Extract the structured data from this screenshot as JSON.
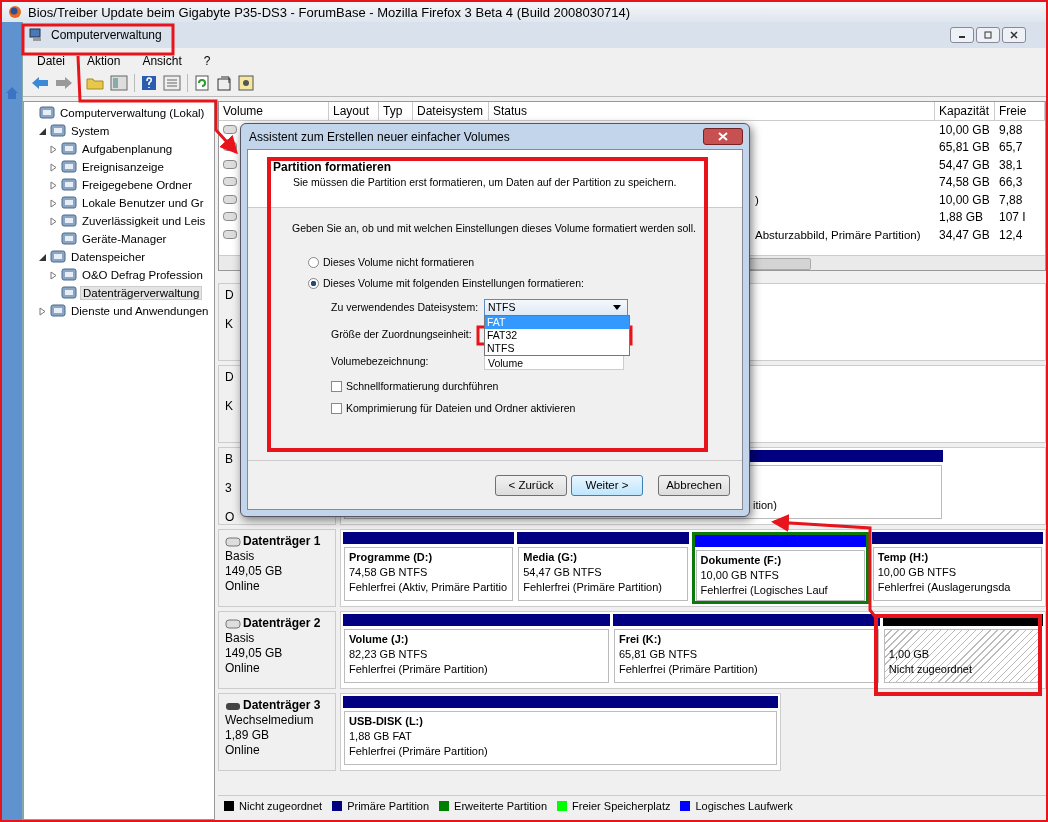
{
  "browser_title": "Bios/Treiber Update beim Gigabyte P35-DS3 - ForumBase - Mozilla Firefox 3 Beta 4 (Build 2008030714)",
  "window": {
    "title": "Computerverwaltung"
  },
  "menu": [
    "Datei",
    "Aktion",
    "Ansicht",
    "?"
  ],
  "tree": [
    {
      "label": "Computerverwaltung (Lokal)",
      "selected": false,
      "children": [
        {
          "label": "System",
          "selected": false,
          "expanded": true,
          "children": [
            {
              "label": "Aufgabenplanung",
              "selected": false,
              "expanded": false
            },
            {
              "label": "Ereignisanzeige",
              "selected": false,
              "expanded": false
            },
            {
              "label": "Freigegebene Ordner",
              "selected": false,
              "expanded": false
            },
            {
              "label": "Lokale Benutzer und Gr",
              "selected": false,
              "expanded": false
            },
            {
              "label": "Zuverlässigkeit und Leis",
              "selected": false,
              "expanded": false
            },
            {
              "label": "Geräte-Manager",
              "selected": false
            }
          ]
        },
        {
          "label": "Datenspeicher",
          "selected": false,
          "expanded": true,
          "children": [
            {
              "label": "O&O Defrag Profession",
              "selected": false,
              "expanded": false
            },
            {
              "label": "Datenträgerverwaltung",
              "selected": true
            }
          ]
        },
        {
          "label": "Dienste und Anwendungen",
          "selected": false,
          "expanded": false
        }
      ]
    }
  ],
  "volume_table": {
    "columns": [
      "Volume",
      "Layout",
      "Typ",
      "Dateisystem",
      "Status",
      "Kapazität",
      "Freie"
    ],
    "rows": [
      {
        "capacity": "10,00 GB",
        "free": "9,88"
      },
      {
        "capacity": "65,81 GB",
        "free": "65,7"
      },
      {
        "capacity": "54,47 GB",
        "free": "38,1"
      },
      {
        "capacity": "74,58 GB",
        "free": "66,3"
      },
      {
        "status": ")",
        "capacity": "10,00 GB",
        "free": "7,88"
      },
      {
        "capacity": "1,88 GB",
        "free": "107 I"
      },
      {
        "status": "Absturzabbild, Primäre Partition)",
        "capacity": "34,47 GB",
        "free": "12,4"
      }
    ]
  },
  "hidden_disks": [
    {
      "label_lines": [
        "D",
        "K"
      ]
    },
    {
      "label_lines": [
        "D",
        "K"
      ]
    },
    {
      "label_lines": [
        "B",
        "3",
        "O"
      ],
      "partition_text": "ition)"
    }
  ],
  "disks": [
    {
      "name": "Datenträger 1",
      "kind": "basic",
      "lines": [
        "Basis",
        "149,05 GB",
        "Online"
      ],
      "partitions": [
        {
          "kind": "primary",
          "name": "Programme  (D:)",
          "size": "74,58 GB NTFS",
          "status": "Fehlerfrei (Aktiv, Primäre Partitio"
        },
        {
          "kind": "primary",
          "name": "Media  (G:)",
          "size": "54,47 GB NTFS",
          "status": "Fehlerfrei (Primäre Partition)"
        },
        {
          "kind": "logical",
          "name": "Dokumente  (F:)",
          "size": "10,00 GB NTFS",
          "status": "Fehlerfrei (Logisches Lauf"
        },
        {
          "kind": "primary",
          "name": "Temp  (H:)",
          "size": "10,00 GB NTFS",
          "status": "Fehlerfrei (Auslagerungsda"
        }
      ]
    },
    {
      "name": "Datenträger 2",
      "kind": "basic",
      "lines": [
        "Basis",
        "149,05 GB",
        "Online"
      ],
      "partitions": [
        {
          "kind": "primary",
          "name": "Volume  (J:)",
          "size": "82,23 GB NTFS",
          "status": "Fehlerfrei (Primäre Partition)"
        },
        {
          "kind": "primary",
          "name": "Frei  (K:)",
          "size": "65,81 GB NTFS",
          "status": "Fehlerfrei (Primäre Partition)"
        },
        {
          "kind": "unallocated",
          "size": "1,00 GB",
          "status": "Nicht zugeordnet"
        }
      ]
    },
    {
      "name": "Datenträger 3",
      "kind": "removable",
      "lines": [
        "Wechselmedium",
        "1,89 GB",
        "Online"
      ],
      "partitions": [
        {
          "kind": "primary",
          "name": "USB-DISK  (L:)",
          "size": "1,88 GB FAT",
          "status": "Fehlerfrei (Primäre Partition)"
        }
      ]
    }
  ],
  "legend": [
    {
      "label": "Nicht zugeordnet",
      "color": "#000000"
    },
    {
      "label": "Primäre Partition",
      "color": "#000080"
    },
    {
      "label": "Erweiterte Partition",
      "color": "#008000"
    },
    {
      "label": "Freier Speicherplatz",
      "color": "#00ff00"
    },
    {
      "label": "Logisches Laufwerk",
      "color": "#0000ff"
    }
  ],
  "dialog": {
    "title": "Assistent zum Erstellen neuer einfacher Volumes",
    "heading": "Partition formatieren",
    "subheading": "Sie müssen die Partition erst formatieren, um Daten auf der Partition zu speichern.",
    "prompt": "Geben Sie an, ob und mit welchen Einstellungen dieses Volume formatiert werden soll.",
    "options": [
      {
        "label": "Dieses Volume nicht formatieren",
        "selected": false
      },
      {
        "label": "Dieses Volume mit folgenden Einstellungen formatieren:",
        "selected": true
      }
    ],
    "filesystem_label": "Zu verwendendes Dateisystem:",
    "filesystem_value": "NTFS",
    "dropdown_items": [
      {
        "label": "FAT",
        "selected": true
      },
      {
        "label": "FAT32",
        "selected": false
      },
      {
        "label": "NTFS",
        "selected": false
      }
    ],
    "allocation_label": "Größe der Zuordnungseinheit:",
    "volume_label_label": "Volumebezeichnung:",
    "volume_label_value": "Volume",
    "checkboxes": [
      {
        "label": "Schnellformatierung durchführen",
        "checked": false
      },
      {
        "label": "Komprimierung für Dateien und Ordner aktivieren",
        "checked": false
      }
    ],
    "buttons": [
      {
        "label": "< Zurück",
        "default": false
      },
      {
        "label": "Weiter >",
        "default": true
      },
      {
        "label": "Abbrechen",
        "default": false
      }
    ]
  }
}
